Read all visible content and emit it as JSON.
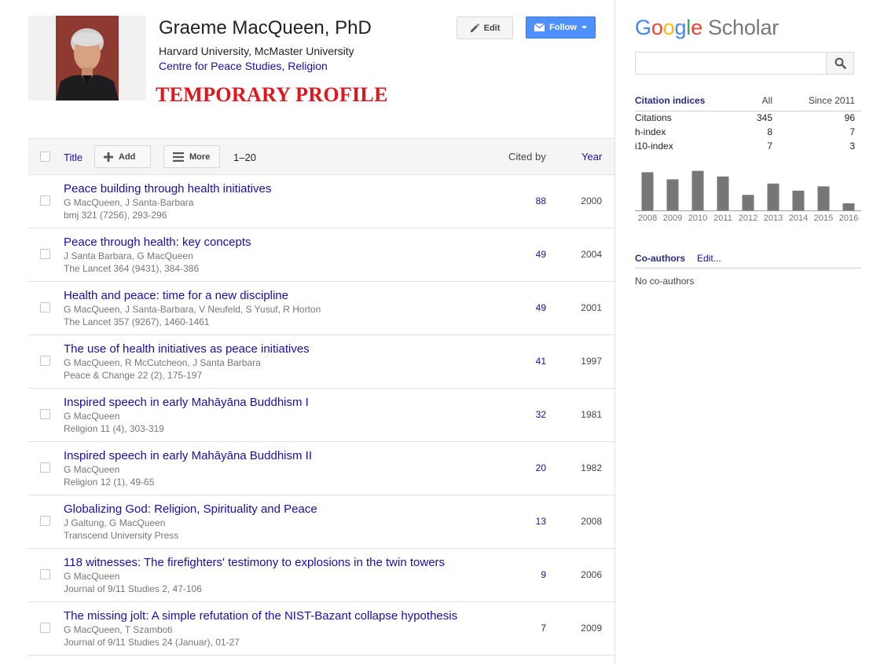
{
  "profile": {
    "name": "Graeme MacQueen, PhD",
    "affiliation": "Harvard University, McMaster University",
    "interests": [
      "Centre for Peace Studies",
      "Religion"
    ],
    "interest_separator": ", ",
    "temporary_notice": "TEMPORARY PROFILE"
  },
  "actions": {
    "edit_label": "Edit",
    "follow_label": "Follow"
  },
  "table": {
    "header": {
      "title": "Title",
      "add": "Add",
      "more": "More",
      "range": "1–20",
      "cited_by": "Cited by",
      "year": "Year"
    },
    "rows": [
      {
        "title": "Peace building through health initiatives",
        "authors": "G MacQueen, J Santa-Barbara",
        "venue": "bmj 321 (7256), 293-296",
        "cited": "88",
        "year": "2000"
      },
      {
        "title": "Peace through health: key concepts",
        "authors": "J Santa Barbara, G MacQueen",
        "venue": "The Lancet 364 (9431), 384-386",
        "cited": "49",
        "year": "2004"
      },
      {
        "title": "Health and peace: time for a new discipline",
        "authors": "G MacQueen, J Santa-Barbara, V Neufeld, S Yusuf, R Horton",
        "venue": "The Lancet 357 (9267), 1460-1461",
        "cited": "49",
        "year": "2001"
      },
      {
        "title": "The use of health initiatives as peace initiatives",
        "authors": "G MacQueen, R McCutcheon, J Santa Barbara",
        "venue": "Peace & Change 22 (2), 175-197",
        "cited": "41",
        "year": "1997"
      },
      {
        "title": "Inspired speech in early Mahāyāna Buddhism I",
        "authors": "G MacQueen",
        "venue": "Religion 11 (4), 303-319",
        "cited": "32",
        "year": "1981"
      },
      {
        "title": "Inspired speech in early Mahāyāna Buddhism II",
        "authors": "G MacQueen",
        "venue": "Religion 12 (1), 49-65",
        "cited": "20",
        "year": "1982"
      },
      {
        "title": "Globalizing God: Religion, Spirituality and Peace",
        "authors": "J Galtung, G MacQueen",
        "venue": "Transcend University Press",
        "cited": "13",
        "year": "2008"
      },
      {
        "title": "118 witnesses: The firefighters' testimony to explosions in the twin towers",
        "authors": "G MacQueen",
        "venue": "Journal of 9/11 Studies 2, 47-106",
        "cited": "9",
        "year": "2006"
      },
      {
        "title": "The missing jolt: A simple refutation of the NIST-Bazant collapse hypothesis",
        "authors": "G MacQueen, T Szamboti",
        "venue": "Journal of 9/11 Studies 24 (Januar), 01-27",
        "cited": "7",
        "year": "2009"
      }
    ]
  },
  "sidebar": {
    "logo_word": "Google",
    "logo_suffix": "Scholar",
    "logo_colors": [
      "#4285f4",
      "#ea4335",
      "#fbbc05",
      "#4285f4",
      "#34a853",
      "#ea4335"
    ],
    "search_placeholder": "",
    "citation_indices": {
      "label": "Citation indices",
      "col_all": "All",
      "col_since": "Since 2011",
      "rows": [
        {
          "label": "Citations",
          "all": "345",
          "since": "96"
        },
        {
          "label": "h-index",
          "all": "8",
          "since": "7"
        },
        {
          "label": "i10-index",
          "all": "7",
          "since": "3"
        }
      ]
    },
    "coauthors": {
      "label": "Co-authors",
      "edit": "Edit...",
      "empty": "No co-authors"
    }
  },
  "chart_data": {
    "type": "bar",
    "categories": [
      "2008",
      "2009",
      "2010",
      "2011",
      "2012",
      "2013",
      "2014",
      "2015",
      "2016"
    ],
    "values": [
      27,
      22,
      28,
      24,
      11,
      19,
      14,
      17,
      5
    ],
    "ylim": [
      0,
      30
    ],
    "bar_color": "#777777",
    "grid": false
  }
}
